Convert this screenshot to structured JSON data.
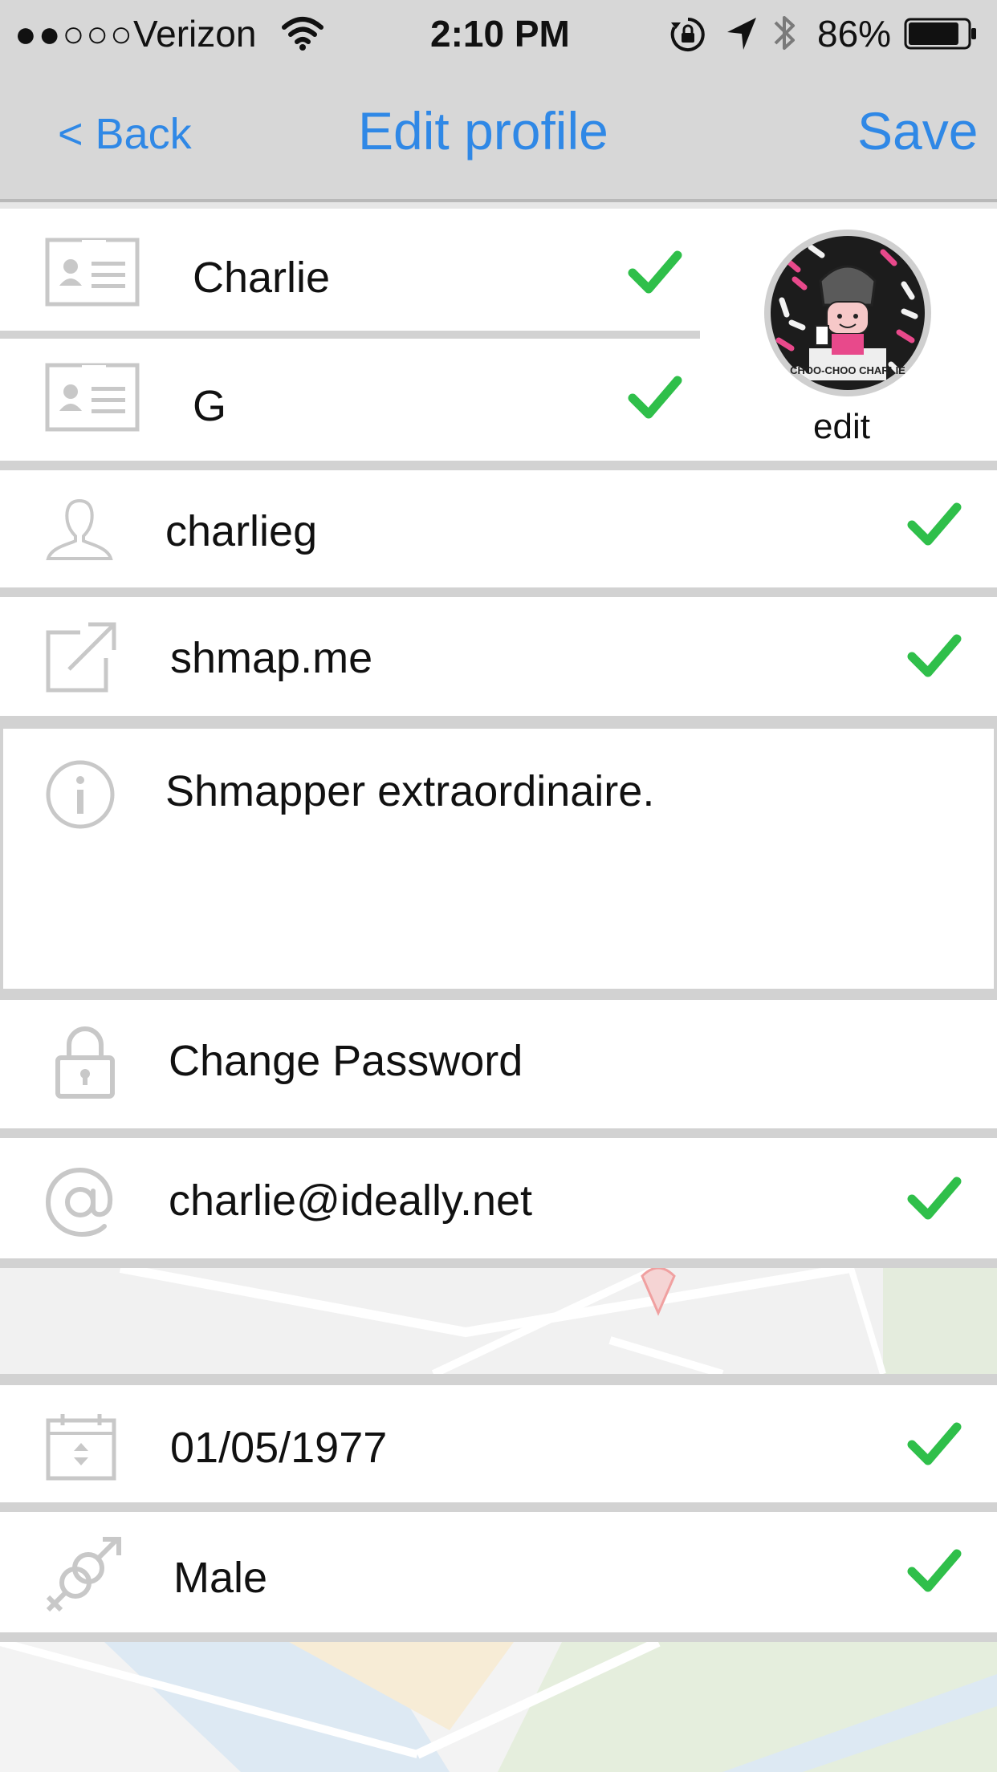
{
  "status_bar": {
    "signal_dots": "●●○○○",
    "carrier": "Verizon",
    "time": "2:10 PM",
    "battery": "86%",
    "battery_level": 0.86
  },
  "nav": {
    "back_label": "< Back",
    "title": "Edit profile",
    "save_label": "Save"
  },
  "avatar": {
    "edit_label": "edit",
    "caption": "CHOO-CHOO CHARLIE"
  },
  "fields": {
    "first_name": "Charlie",
    "last_name": "G",
    "username": "charlieg",
    "website": "shmap.me",
    "bio": "Shmapper extraordinaire.",
    "change_password": "Change Password",
    "email": "charlie@ideally.net",
    "birthdate": "01/05/1977",
    "gender": "Male"
  },
  "colors": {
    "accent": "#2f88e6",
    "check": "#2fbf4a",
    "icon_gray": "#c8c8c8"
  }
}
